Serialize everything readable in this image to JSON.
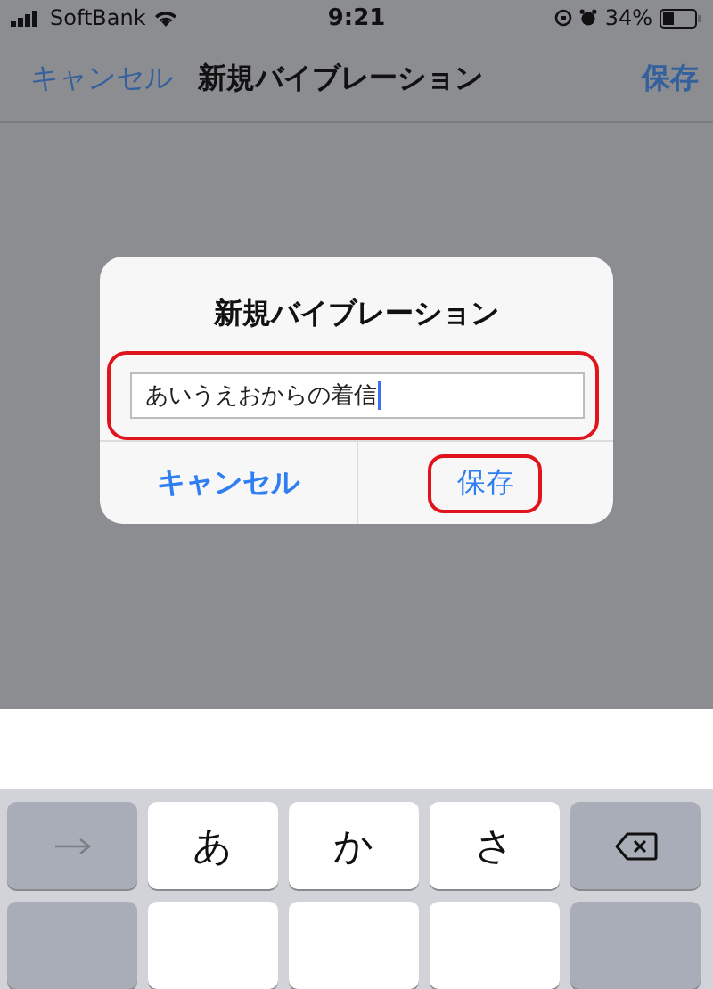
{
  "status_bar": {
    "carrier": "SoftBank",
    "time": "9:21",
    "battery": "34%"
  },
  "nav_bar": {
    "cancel": "キャンセル",
    "title": "新規バイブレーション",
    "save": "保存"
  },
  "dialog": {
    "title": "新規バイブレーション",
    "field": {
      "value": "あいうえおからの着信",
      "highlighted": true
    },
    "buttons": [
      {
        "label": "キャンセル",
        "kind": "cancel",
        "highlighted": false
      },
      {
        "label": "保存",
        "kind": "default",
        "highlighted": true
      }
    ]
  },
  "keyboard": {
    "rows": [
      [
        {
          "kind": "arrow"
        },
        {
          "kind": "char",
          "label": "あ"
        },
        {
          "kind": "char",
          "label": "か"
        },
        {
          "kind": "char",
          "label": "さ"
        },
        {
          "kind": "delete"
        }
      ],
      [
        {
          "kind": "function"
        },
        {
          "kind": "char"
        },
        {
          "kind": "char"
        },
        {
          "kind": "char"
        },
        {
          "kind": "function"
        }
      ]
    ]
  }
}
